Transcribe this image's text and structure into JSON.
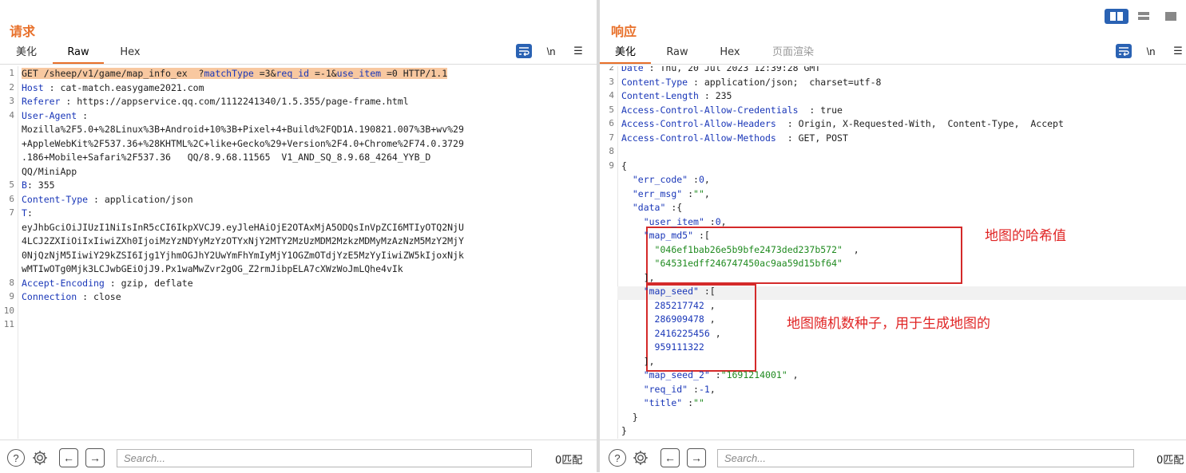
{
  "left": {
    "title": "请求",
    "tabs": [
      "美化",
      "Raw",
      "Hex"
    ],
    "active_tab": "Raw",
    "lines": [
      {
        "n": "1",
        "parts": [
          [
            "hl",
            "GET /sheep/v1/game/map_info_ex  ?"
          ],
          [
            "hlp",
            "matchType"
          ],
          [
            "hl",
            " =3&"
          ],
          [
            "hlp",
            "req_id"
          ],
          [
            "hl",
            " =-1&"
          ],
          [
            "hlp",
            "use_item"
          ],
          [
            "hl",
            " =0 HTTP/1.1"
          ]
        ]
      },
      {
        "n": "2",
        "parts": [
          [
            "key",
            "Host"
          ],
          [
            "txt",
            " : cat-match.easygame2021.com"
          ]
        ]
      },
      {
        "n": "3",
        "parts": [
          [
            "key",
            "Referer"
          ],
          [
            "txt",
            " : https://appservice.qq.com/1112241340/1.5.355/page-frame.html"
          ]
        ]
      },
      {
        "n": "4",
        "parts": [
          [
            "key",
            "User-Agent"
          ],
          [
            "txt",
            " :"
          ]
        ]
      },
      {
        "n": "",
        "parts": [
          [
            "txt",
            "Mozilla%2F5.0+%28Linux%3B+Android+10%3B+Pixel+4+Build%2FQD1A.190821.007%3B+wv%29"
          ]
        ]
      },
      {
        "n": "",
        "parts": [
          [
            "txt",
            "+AppleWebKit%2F537.36+%28KHTML%2C+like+Gecko%29+Version%2F4.0+Chrome%2F74.0.3729"
          ]
        ]
      },
      {
        "n": "",
        "parts": [
          [
            "txt",
            ".186+Mobile+Safari%2F537.36   QQ/8.9.68.11565  V1_AND_SQ_8.9.68_4264_YYB_D"
          ]
        ]
      },
      {
        "n": "",
        "parts": [
          [
            "txt",
            "QQ/MiniApp"
          ]
        ]
      },
      {
        "n": "5",
        "parts": [
          [
            "key",
            "B"
          ],
          [
            "txt",
            ": 355"
          ]
        ]
      },
      {
        "n": "6",
        "parts": [
          [
            "key",
            "Content-Type"
          ],
          [
            "txt",
            " : application/json"
          ]
        ]
      },
      {
        "n": "7",
        "parts": [
          [
            "key",
            "T"
          ],
          [
            "txt",
            ":"
          ]
        ]
      },
      {
        "n": "",
        "parts": [
          [
            "txt",
            "eyJhbGciOiJIUzI1NiIsInR5cCI6IkpXVCJ9.eyJleHAiOjE2OTAxMjA5ODQsInVpZCI6MTIyOTQ2NjU"
          ]
        ]
      },
      {
        "n": "",
        "parts": [
          [
            "txt",
            "4LCJ2ZXIiOiIxIiwiZXh0IjoiMzYzNDYyMzYzOTYxNjY2MTY2MzUzMDM2MzkzMDMyMzAzNzM5MzY2MjY"
          ]
        ]
      },
      {
        "n": "",
        "parts": [
          [
            "txt",
            "0NjQzNjM5IiwiY29kZSI6Ijg1YjhmOGJhY2UwYmFhYmIyMjY1OGZmOTdjYzE5MzYyIiwiZW5kIjoxNjk"
          ]
        ]
      },
      {
        "n": "",
        "parts": [
          [
            "txt",
            "wMTIwOTg0Mjk3LCJwbGEiOjJ9.Px1waMwZvr2gOG_Z2rmJibpELA7cXWzWoJmLQhe4vIk"
          ]
        ]
      },
      {
        "n": "8",
        "parts": [
          [
            "key",
            "Accept-Encoding"
          ],
          [
            "txt",
            " : gzip, deflate"
          ]
        ]
      },
      {
        "n": "9",
        "parts": [
          [
            "key",
            "Connection"
          ],
          [
            "txt",
            " : close"
          ]
        ]
      },
      {
        "n": "10",
        "parts": []
      },
      {
        "n": "11",
        "parts": []
      }
    ],
    "search_placeholder": "Search...",
    "matches": "0匹配"
  },
  "right": {
    "title": "响应",
    "tabs": [
      "美化",
      "Raw",
      "Hex",
      "页面渲染"
    ],
    "active_tab": "美化",
    "lines": [
      {
        "n": "2",
        "parts": [
          [
            "key",
            "Date"
          ],
          [
            "txt",
            " : Thu, 20 Jul 2023 12:39:28 GMT"
          ]
        ]
      },
      {
        "n": "3",
        "parts": [
          [
            "key",
            "Content-Type"
          ],
          [
            "txt",
            " : application/json;  charset=utf-8"
          ]
        ]
      },
      {
        "n": "4",
        "parts": [
          [
            "key",
            "Content-Length"
          ],
          [
            "txt",
            " : 235"
          ]
        ]
      },
      {
        "n": "5",
        "parts": [
          [
            "key",
            "Access-Control-Allow-Credentials"
          ],
          [
            "txt",
            "  : true"
          ]
        ]
      },
      {
        "n": "6",
        "parts": [
          [
            "key",
            "Access-Control-Allow-Headers"
          ],
          [
            "txt",
            "  : Origin, X-Requested-With,  Content-Type,  Accept"
          ]
        ]
      },
      {
        "n": "7",
        "parts": [
          [
            "key",
            "Access-Control-Allow-Methods"
          ],
          [
            "txt",
            "  : GET, POST"
          ]
        ]
      },
      {
        "n": "8",
        "parts": []
      },
      {
        "n": "9",
        "parts": [
          [
            "txt",
            "{"
          ]
        ]
      },
      {
        "n": "",
        "parts": [
          [
            "txt",
            "  "
          ],
          [
            "key",
            "\"err_code\""
          ],
          [
            "txt",
            " :"
          ],
          [
            "num",
            "0"
          ],
          [
            "txt",
            ","
          ]
        ]
      },
      {
        "n": "",
        "parts": [
          [
            "txt",
            "  "
          ],
          [
            "key",
            "\"err_msg\""
          ],
          [
            "txt",
            " :"
          ],
          [
            "str",
            "\"\""
          ],
          [
            "txt",
            ","
          ]
        ]
      },
      {
        "n": "",
        "parts": [
          [
            "txt",
            "  "
          ],
          [
            "key",
            "\"data\""
          ],
          [
            "txt",
            " :{"
          ]
        ]
      },
      {
        "n": "",
        "parts": [
          [
            "txt",
            "    "
          ],
          [
            "key",
            "\"user_item\""
          ],
          [
            "txt",
            " :"
          ],
          [
            "num",
            "0"
          ],
          [
            "txt",
            ","
          ]
        ]
      },
      {
        "n": "",
        "parts": [
          [
            "txt",
            "    "
          ],
          [
            "key",
            "\"map_md5\""
          ],
          [
            "txt",
            " :["
          ]
        ]
      },
      {
        "n": "",
        "parts": [
          [
            "txt",
            "      "
          ],
          [
            "str",
            "\"046ef1bab26e5b9bfe2473ded237b572\""
          ],
          [
            "txt",
            "  ,"
          ]
        ]
      },
      {
        "n": "",
        "parts": [
          [
            "txt",
            "      "
          ],
          [
            "str",
            "\"64531edff246747450ac9aa59d15bf64\""
          ]
        ]
      },
      {
        "n": "",
        "parts": [
          [
            "txt",
            "    ],"
          ]
        ]
      },
      {
        "n": "",
        "parts": [
          [
            "txt",
            "    "
          ],
          [
            "key",
            "\"map_seed\""
          ],
          [
            "txt",
            " :["
          ]
        ]
      },
      {
        "n": "",
        "parts": [
          [
            "txt",
            "      "
          ],
          [
            "num",
            "285217742"
          ],
          [
            "txt",
            " ,"
          ]
        ]
      },
      {
        "n": "",
        "parts": [
          [
            "txt",
            "      "
          ],
          [
            "num",
            "286909478"
          ],
          [
            "txt",
            " ,"
          ]
        ]
      },
      {
        "n": "",
        "parts": [
          [
            "txt",
            "      "
          ],
          [
            "num",
            "2416225456"
          ],
          [
            "txt",
            " ,"
          ]
        ]
      },
      {
        "n": "",
        "parts": [
          [
            "txt",
            "      "
          ],
          [
            "num",
            "959111322"
          ]
        ]
      },
      {
        "n": "",
        "parts": [
          [
            "txt",
            "    ],"
          ]
        ]
      },
      {
        "n": "",
        "parts": [
          [
            "txt",
            "    "
          ],
          [
            "key",
            "\"map_seed_2\""
          ],
          [
            "txt",
            " :"
          ],
          [
            "str",
            "\"1691214001\""
          ],
          [
            "txt",
            " ,"
          ]
        ]
      },
      {
        "n": "",
        "parts": [
          [
            "txt",
            "    "
          ],
          [
            "key",
            "\"req_id\""
          ],
          [
            "txt",
            " :"
          ],
          [
            "num",
            "-1"
          ],
          [
            "txt",
            ","
          ]
        ]
      },
      {
        "n": "",
        "parts": [
          [
            "txt",
            "    "
          ],
          [
            "key",
            "\"title\""
          ],
          [
            "txt",
            " :"
          ],
          [
            "str",
            "\"\""
          ]
        ]
      },
      {
        "n": "",
        "parts": [
          [
            "txt",
            "  }"
          ]
        ]
      },
      {
        "n": "",
        "parts": [
          [
            "txt",
            "}"
          ]
        ]
      }
    ],
    "annotations": {
      "md5_note": "地图的哈希值",
      "seed_note": "地图随机数种子，用于生成地图的"
    },
    "search_placeholder": "Search...",
    "matches": "0匹配"
  },
  "toolbar": {
    "newline_label": "\\n",
    "menu_label": "☰"
  },
  "colors": {
    "accent": "#e8702a",
    "key": "#1a37b8",
    "string": "#1f8a1f",
    "highlight": "#f8c8a0",
    "annotation": "#e02525",
    "active_toggle": "#2a62b3"
  }
}
